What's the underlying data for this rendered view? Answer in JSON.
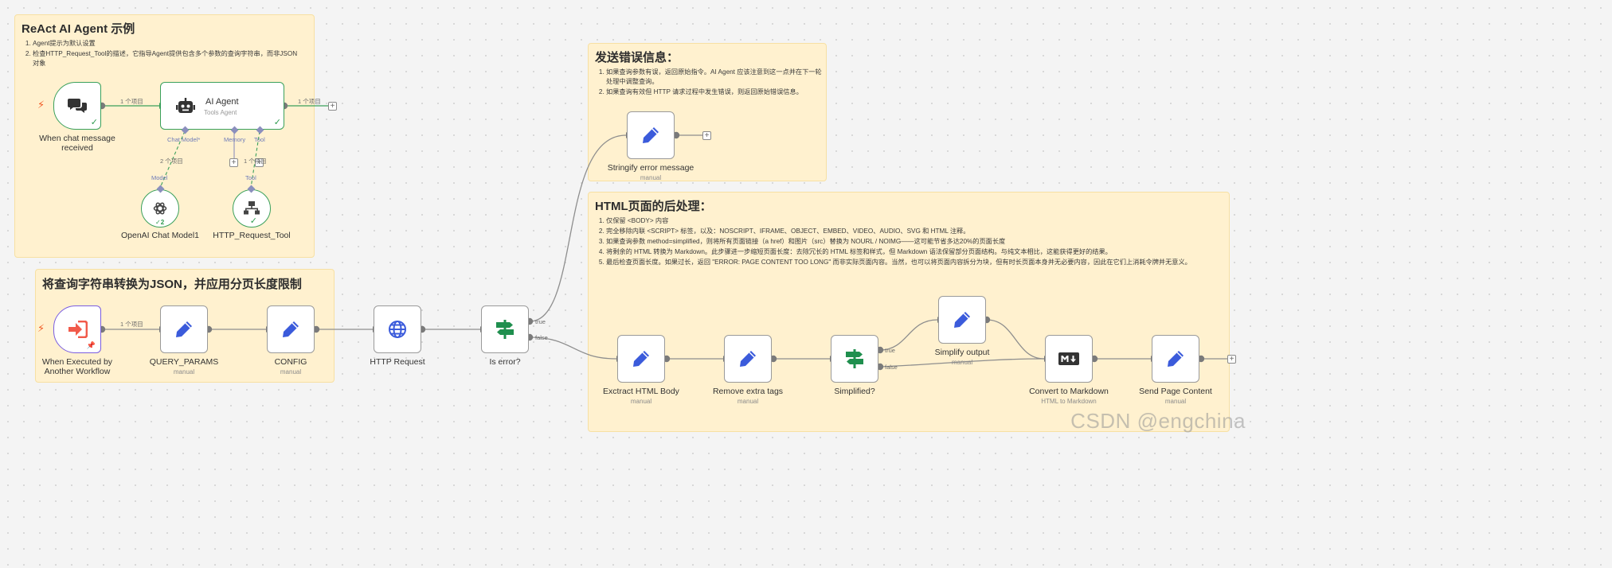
{
  "stickies": {
    "react": {
      "title": "ReAct AI Agent 示例",
      "items": [
        "Agent提示为默认设置",
        "检查HTTP_Request_Tool的描述，它指导Agent提供包含多个参数的查询字符串，而非JSON对象"
      ]
    },
    "convert": {
      "title": "将查询字符串转换为JSON，并应用分页长度限制"
    },
    "error": {
      "title": "发送错误信息：",
      "items": [
        "如果查询参数有误，返回原始指令。AI Agent 应该注意到这一点并在下一轮处理中调整查询。",
        "如果查询有效但 HTTP 请求过程中发生错误，则返回原始错误信息。"
      ]
    },
    "html": {
      "title": "HTML页面的后处理：",
      "items": [
        "仅保留 <BODY> 内容",
        "完全移除内联 <SCRIPT> 标签，以及：NOSCRIPT、IFRAME、OBJECT、EMBED、VIDEO、AUDIO、SVG 和 HTML 注释。",
        "如果查询参数 method=simplified，则将所有页面链接（a href）和图片（src）替换为 NOURL / NOIMG——这可能节省多达20%的页面长度",
        "将剩余的 HTML 转换为 Markdown。此步骤进一步缩短页面长度：去除冗长的 HTML 标签和样式，但 Markdown 语法保留部分页面结构。与纯文本相比，这能获得更好的结果。",
        "最后检查页面长度。如果过长，返回 \"ERROR: PAGE CONTENT TOO LONG\" 而非实际页面内容。当然，也可以将页面内容拆分为块，但有时长页面本身并无必要内容，因此在它们上消耗令牌并无意义。"
      ]
    }
  },
  "nodes": {
    "chat_trigger": {
      "label": "When chat message received"
    },
    "ai_agent": {
      "title": "AI Agent",
      "sub": "Tools Agent"
    },
    "openai": {
      "label": "OpenAI Chat Model1",
      "badge": "2"
    },
    "http_tool": {
      "label": "HTTP_Request_Tool"
    },
    "exec_trigger": {
      "label": "When Executed by Another Workflow"
    },
    "query_params": {
      "label": "QUERY_PARAMS",
      "sub": "manual"
    },
    "config": {
      "label": "CONFIG",
      "sub": "manual"
    },
    "http_request": {
      "label": "HTTP Request"
    },
    "is_error": {
      "label": "Is error?"
    },
    "stringify": {
      "label": "Stringify error message",
      "sub": "manual"
    },
    "extract_html": {
      "label": "Exctract HTML Body",
      "sub": "manual"
    },
    "remove_tags": {
      "label": "Remove extra tags",
      "sub": "manual"
    },
    "simplified": {
      "label": "Simplified?"
    },
    "simplify_output": {
      "label": "Simplify output",
      "sub": "manual"
    },
    "to_markdown": {
      "label": "Convert to Markdown",
      "sub": "HTML to Markdown"
    },
    "send_page": {
      "label": "Send Page Content",
      "sub": "manual"
    }
  },
  "connections": {
    "one_item": "1 个项目",
    "two_items": "2 个项目",
    "true_label": "true",
    "false_label": "false",
    "chat_model": "Chat Model*",
    "memory": "Memory",
    "tool": "Tool",
    "model": "Model"
  },
  "watermark": "CSDN @engchina",
  "colors": {
    "sticky_bg": "#fff1cf",
    "success_green": "#3aa05b",
    "trigger_orange": "#f15a24",
    "icon_blue": "#3b5bdb",
    "if_green": "#1f8f4e"
  }
}
